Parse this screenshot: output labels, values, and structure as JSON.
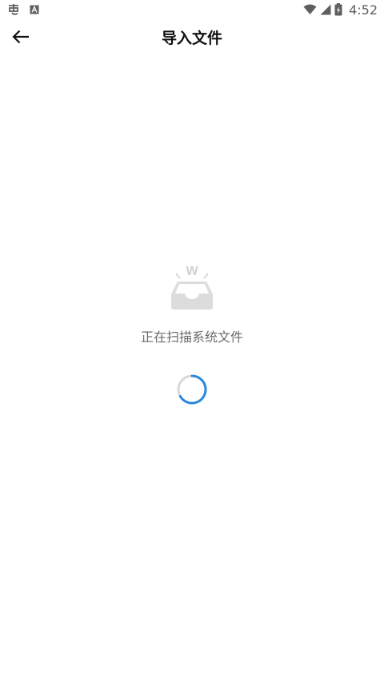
{
  "status_bar": {
    "time": "4:52",
    "left_icons": [
      "notification-app-icon",
      "text-a-icon"
    ],
    "right_icons": [
      "wifi-icon",
      "cellular-signal-icon",
      "battery-icon"
    ]
  },
  "header": {
    "title": "导入文件",
    "back_icon": "arrow-left-icon"
  },
  "loading": {
    "illustration_icon": "inbox-tray-icon",
    "badge_letter": "W",
    "message": "正在扫描系统文件",
    "spinner_color": "#2a88e0"
  },
  "colors": {
    "background": "#ffffff",
    "title": "#111111",
    "secondary_text": "#6b6b6b",
    "illustration": "#dcdcdc",
    "accent": "#2a88e0"
  }
}
